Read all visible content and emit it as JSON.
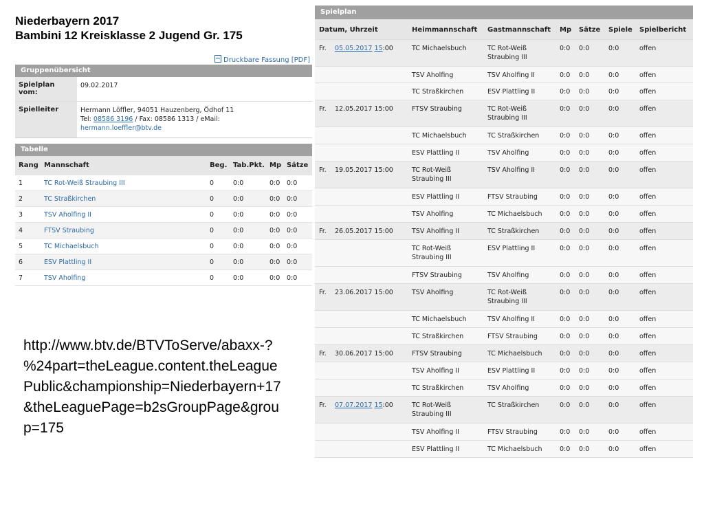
{
  "title_line1": "Niederbayern 2017",
  "title_line2": "Bambini 12 Kreisklasse 2 Jugend Gr. 175",
  "print_link": "Druckbare Fassung [PDF]",
  "icons": {
    "print": "document-icon"
  },
  "group_overview": {
    "header": "Gruppenübersicht",
    "plan_label": "Spielplan vom:",
    "plan_value": "09.02.2017",
    "leader_label": "Spielleiter",
    "leader_line1": "Hermann Löffler, 94051 Hauzenberg, Ödhof 11",
    "tel_prefix": "Tel: ",
    "tel": "08586 3196",
    "fax_email": " / Fax: 08586 1313 / eMail:",
    "email": "hermann.loeffler@btv.de"
  },
  "table": {
    "header": "Tabelle",
    "columns": [
      "Rang",
      "Mannschaft",
      "Beg.",
      "Tab.Pkt.",
      "Mp",
      "Sätze"
    ],
    "rows": [
      [
        "1",
        "TC Rot-Weiß Straubing III",
        "0",
        "0:0",
        "0:0",
        "0:0"
      ],
      [
        "2",
        "TC Straßkirchen",
        "0",
        "0:0",
        "0:0",
        "0:0"
      ],
      [
        "3",
        "TSV Aholfing II",
        "0",
        "0:0",
        "0:0",
        "0:0"
      ],
      [
        "4",
        "FTSV Straubing",
        "0",
        "0:0",
        "0:0",
        "0:0"
      ],
      [
        "5",
        "TC Michaelsbuch",
        "0",
        "0:0",
        "0:0",
        "0:0"
      ],
      [
        "6",
        "ESV Plattling II",
        "0",
        "0:0",
        "0:0",
        "0:0"
      ],
      [
        "7",
        "TSV Aholfing",
        "0",
        "0:0",
        "0:0",
        "0:0"
      ]
    ]
  },
  "url_text": "http://www.btv.de/BTVToServe/abaxx-?%24part=theLeague.content.theLeaguePublic&championship=Niederbayern+17&theLeaguePage=b2sGroupPage&group=175",
  "spielplan": {
    "header": "Spielplan",
    "columns": [
      "Datum, Uhrzeit",
      "Heimmannschaft",
      "Gastmannschaft",
      "Mp",
      "Sätze",
      "Spiele",
      "Spielbericht"
    ],
    "rows": [
      {
        "day": "Fr.",
        "date": "05.05.2017",
        "time": "15",
        "time_rest": ":00",
        "linked": true,
        "home": "TC Michaelsbuch",
        "guest": "TC Rot-Weiß Straubing III",
        "mp": "0:0",
        "saetze": "0:0",
        "spiele": "0:0",
        "bericht": "offen",
        "h": 39
      },
      {
        "day": "",
        "date": "",
        "time": "",
        "time_rest": "",
        "linked": false,
        "home": "TSV Aholfing",
        "guest": "TSV Aholfing II",
        "mp": "0:0",
        "saetze": "0:0",
        "spiele": "0:0",
        "bericht": "offen",
        "h": 24
      },
      {
        "day": "",
        "date": "",
        "time": "",
        "time_rest": "",
        "linked": false,
        "home": "TC Straßkirchen",
        "guest": "ESV Plattling II",
        "mp": "0:0",
        "saetze": "0:0",
        "spiele": "0:0",
        "bericht": "offen",
        "h": 25
      },
      {
        "day": "Fr.",
        "date": "12.05.2017 15:00",
        "time": "",
        "time_rest": "",
        "linked": false,
        "home": "FTSV Straubing",
        "guest": "TC Rot-Weiß Straubing III",
        "mp": "0:0",
        "saetze": "0:0",
        "spiele": "0:0",
        "bericht": "offen",
        "h": 39
      },
      {
        "day": "",
        "date": "",
        "time": "",
        "time_rest": "",
        "linked": false,
        "home": "TC Michaelsbuch",
        "guest": "TC Straßkirchen",
        "mp": "0:0",
        "saetze": "0:0",
        "spiele": "0:0",
        "bericht": "offen",
        "h": 25
      },
      {
        "day": "",
        "date": "",
        "time": "",
        "time_rest": "",
        "linked": false,
        "home": "ESV Plattling II",
        "guest": "TSV Aholfing",
        "mp": "0:0",
        "saetze": "0:0",
        "spiele": "0:0",
        "bericht": "offen",
        "h": 25
      },
      {
        "day": "Fr.",
        "date": "19.05.2017 15:00",
        "time": "",
        "time_rest": "",
        "linked": false,
        "home": "TC Rot-Weiß Straubing III",
        "guest": "TSV Aholfing II",
        "mp": "0:0",
        "saetze": "0:0",
        "spiele": "0:0",
        "bericht": "offen",
        "h": 39
      },
      {
        "day": "",
        "date": "",
        "time": "",
        "time_rest": "",
        "linked": false,
        "home": "ESV Plattling II",
        "guest": "FTSV Straubing",
        "mp": "0:0",
        "saetze": "0:0",
        "spiele": "0:0",
        "bericht": "offen",
        "h": 25
      },
      {
        "day": "",
        "date": "",
        "time": "",
        "time_rest": "",
        "linked": false,
        "home": "TSV Aholfing",
        "guest": "TC Michaelsbuch",
        "mp": "0:0",
        "saetze": "0:0",
        "spiele": "0:0",
        "bericht": "offen",
        "h": 25
      },
      {
        "day": "Fr.",
        "date": "26.05.2017 15:00",
        "time": "",
        "time_rest": "",
        "linked": false,
        "home": "TSV Aholfing II",
        "guest": "TC Straßkirchen",
        "mp": "0:0",
        "saetze": "0:0",
        "spiele": "0:0",
        "bericht": "offen",
        "h": 25
      },
      {
        "day": "",
        "date": "",
        "time": "",
        "time_rest": "",
        "linked": false,
        "home": "TC Rot-Weiß Straubing III",
        "guest": "ESV Plattling II",
        "mp": "0:0",
        "saetze": "0:0",
        "spiele": "0:0",
        "bericht": "offen",
        "h": 39
      },
      {
        "day": "",
        "date": "",
        "time": "",
        "time_rest": "",
        "linked": false,
        "home": "FTSV Straubing",
        "guest": "TSV Aholfing",
        "mp": "0:0",
        "saetze": "0:0",
        "spiele": "0:0",
        "bericht": "offen",
        "h": 25
      },
      {
        "day": "Fr.",
        "date": "23.06.2017 15:00",
        "time": "",
        "time_rest": "",
        "linked": false,
        "home": "TSV Aholfing",
        "guest": "TC Rot-Weiß Straubing III",
        "mp": "0:0",
        "saetze": "0:0",
        "spiele": "0:0",
        "bericht": "offen",
        "h": 39
      },
      {
        "day": "",
        "date": "",
        "time": "",
        "time_rest": "",
        "linked": false,
        "home": "TC Michaelsbuch",
        "guest": "TSV Aholfing II",
        "mp": "0:0",
        "saetze": "0:0",
        "spiele": "0:0",
        "bericht": "offen",
        "h": 25
      },
      {
        "day": "",
        "date": "",
        "time": "",
        "time_rest": "",
        "linked": false,
        "home": "TC Straßkirchen",
        "guest": "FTSV Straubing",
        "mp": "0:0",
        "saetze": "0:0",
        "spiele": "0:0",
        "bericht": "offen",
        "h": 25
      },
      {
        "day": "Fr.",
        "date": "30.06.2017 15:00",
        "time": "",
        "time_rest": "",
        "linked": false,
        "home": "FTSV Straubing",
        "guest": "TC Michaelsbuch",
        "mp": "0:0",
        "saetze": "0:0",
        "spiele": "0:0",
        "bericht": "offen",
        "h": 25
      },
      {
        "day": "",
        "date": "",
        "time": "",
        "time_rest": "",
        "linked": false,
        "home": "TSV Aholfing II",
        "guest": "ESV Plattling II",
        "mp": "0:0",
        "saetze": "0:0",
        "spiele": "0:0",
        "bericht": "offen",
        "h": 25
      },
      {
        "day": "",
        "date": "",
        "time": "",
        "time_rest": "",
        "linked": false,
        "home": "TC Straßkirchen",
        "guest": "TSV Aholfing",
        "mp": "0:0",
        "saetze": "0:0",
        "spiele": "0:0",
        "bericht": "offen",
        "h": 25
      },
      {
        "day": "Fr.",
        "date": "07.07.2017",
        "time": "15",
        "time_rest": ":00",
        "linked": true,
        "home": "TC Rot-Weiß Straubing III",
        "guest": "TC Straßkirchen",
        "mp": "0:0",
        "saetze": "0:0",
        "spiele": "0:0",
        "bericht": "offen",
        "h": 39
      },
      {
        "day": "",
        "date": "",
        "time": "",
        "time_rest": "",
        "linked": false,
        "home": "TSV Aholfing II",
        "guest": "FTSV Straubing",
        "mp": "0:0",
        "saetze": "0:0",
        "spiele": "0:0",
        "bericht": "offen",
        "h": 25
      },
      {
        "day": "",
        "date": "",
        "time": "",
        "time_rest": "",
        "linked": false,
        "home": "ESV Plattling II",
        "guest": "TC Michaelsbuch",
        "mp": "0:0",
        "saetze": "0:0",
        "spiele": "0:0",
        "bericht": "offen",
        "h": 25
      }
    ]
  }
}
